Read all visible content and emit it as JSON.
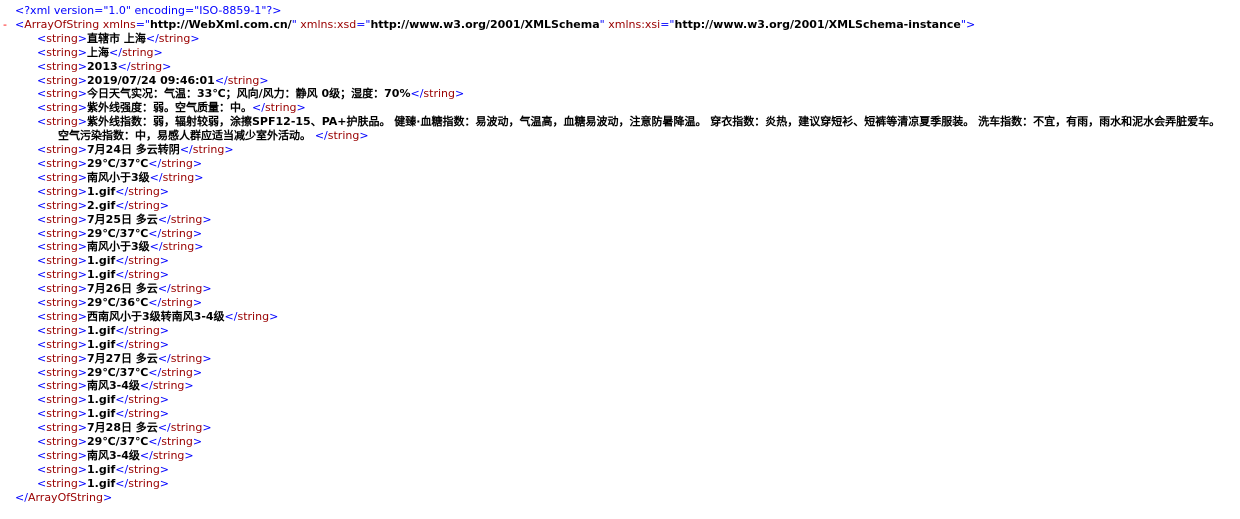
{
  "declaration": "<?xml version=\"1.0\" encoding=\"ISO-8859-1\"?>",
  "root": {
    "toggle": "-",
    "name": "ArrayOfString",
    "attrs": [
      {
        "name": "xmlns",
        "value": "http://WebXml.com.cn/"
      },
      {
        "name": "xmlns:xsd",
        "value": "http://www.w3.org/2001/XMLSchema"
      },
      {
        "name": "xmlns:xsi",
        "value": "http://www.w3.org/2001/XMLSchema-instance"
      }
    ]
  },
  "child_tag": "string",
  "items": [
    "直辖市 上海",
    "上海",
    "2013",
    "2019/07/24 09:46:01",
    "今日天气实况：气温：33℃；风向/风力：静风 0级；湿度：70%",
    "紫外线强度：弱。空气质量：中。",
    "紫外线指数：弱，辐射较弱，涂擦SPF12-15、PA+护肤品。 健臻·血糖指数：易波动，气温高，血糖易波动，注意防暑降温。 穿衣指数：炎热，建议穿短衫、短裤等清凉夏季服装。 洗车指数：不宜，有雨，雨水和泥水会弄脏爱车。 空气污染指数：中，易感人群应适当减少室外活动。 ",
    "7月24日 多云转阴",
    "29℃/37℃",
    "南风小于3级",
    "1.gif",
    "2.gif",
    "7月25日 多云",
    "29℃/37℃",
    "南风小于3级",
    "1.gif",
    "1.gif",
    "7月26日 多云",
    "29℃/36℃",
    "西南风小于3级转南风3-4级",
    "1.gif",
    "1.gif",
    "7月27日 多云",
    "29℃/37℃",
    "南风3-4级",
    "1.gif",
    "1.gif",
    "7月28日 多云",
    "29℃/37℃",
    "南风3-4级",
    "1.gif",
    "1.gif"
  ]
}
